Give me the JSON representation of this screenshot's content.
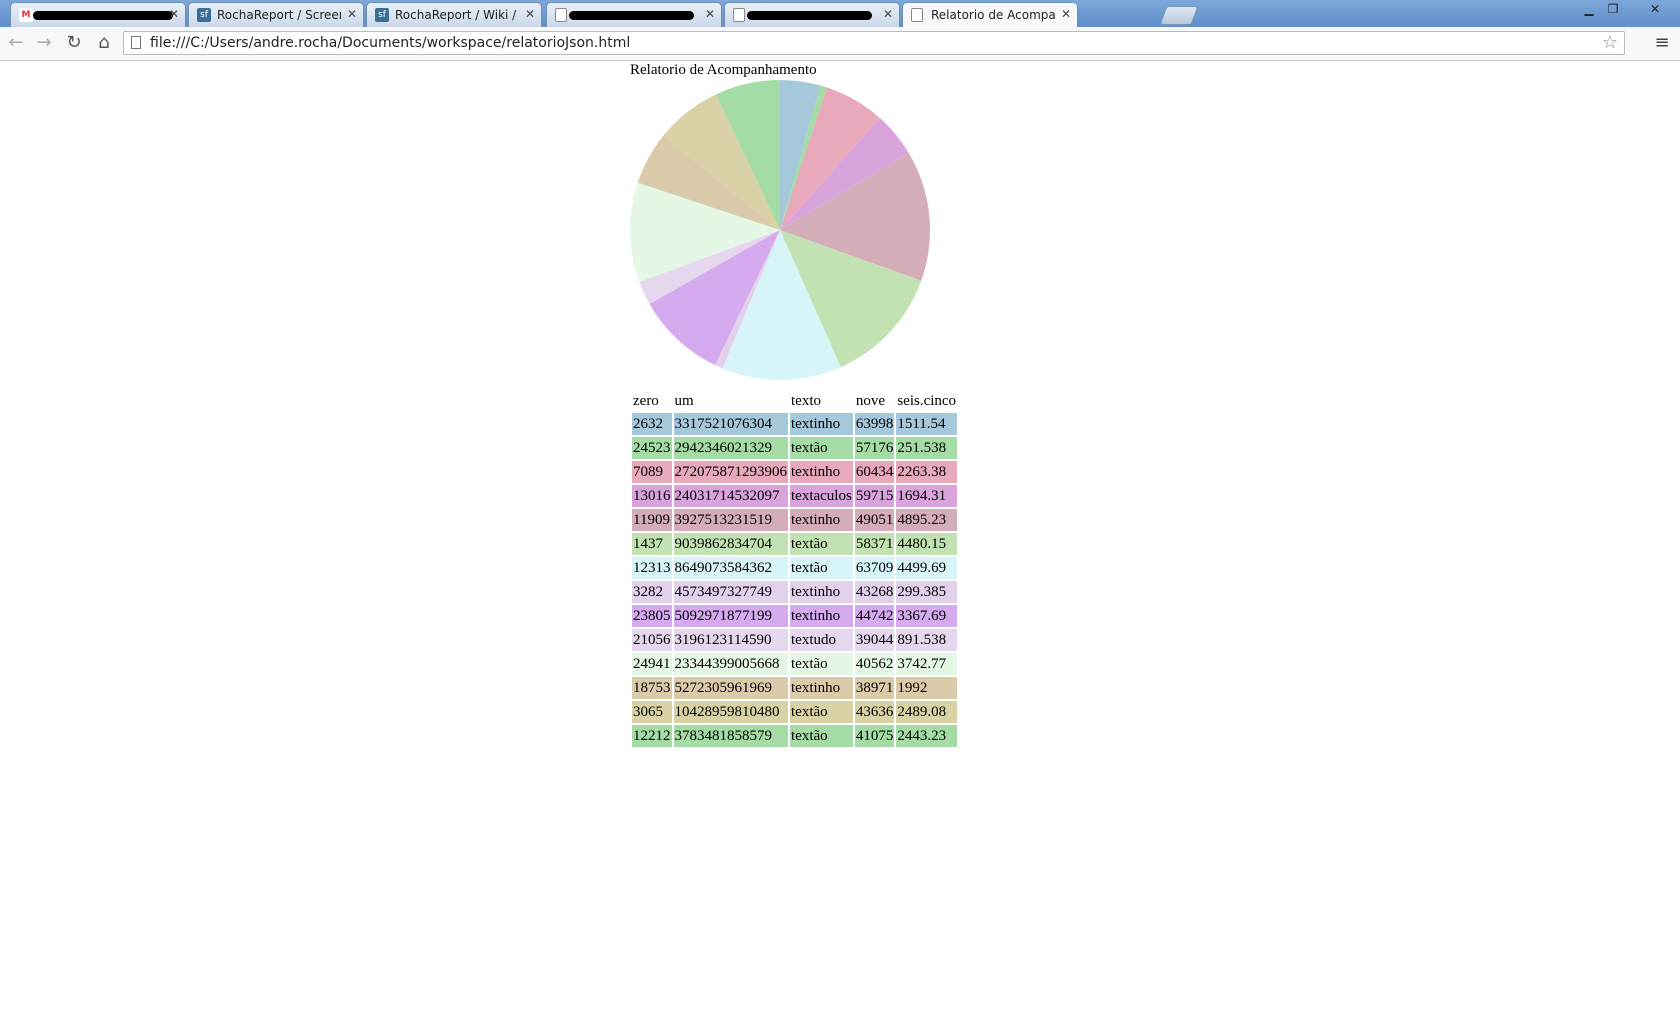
{
  "browser": {
    "tabs": [
      {
        "title": "",
        "favicon": "gmail-icon",
        "redacted": true,
        "active": false
      },
      {
        "title": "RochaReport / Screenshot",
        "favicon": "sf-icon",
        "redacted": false,
        "active": false
      },
      {
        "title": "RochaReport / Wiki / Brow",
        "favicon": "sf-icon",
        "redacted": false,
        "active": false
      },
      {
        "title": "",
        "favicon": "page-icon",
        "redacted": true,
        "active": false
      },
      {
        "title": "",
        "favicon": "page-icon",
        "redacted": true,
        "active": false
      },
      {
        "title": "Relatorio de Acompanhan",
        "favicon": "page-icon",
        "redacted": false,
        "active": true
      }
    ],
    "close_glyph": "✕",
    "window_controls": {
      "minimize": "▁",
      "maximize": "❐",
      "close": "✕"
    },
    "nav": {
      "back": "←",
      "forward": "→",
      "reload": "↻",
      "home": "⌂"
    },
    "url": "file:///C:/Users/andre.rocha/Documents/workspace/relatorioJson.html",
    "star": "☆",
    "menu": "≡"
  },
  "page": {
    "title": "Relatorio de Acompanhamento"
  },
  "chart_data": {
    "type": "pie",
    "title": "Relatorio de Acompanhamento",
    "categories": [
      "2632",
      "24523",
      "7089",
      "13016",
      "11909",
      "1437",
      "12313",
      "3282",
      "23805",
      "21056",
      "24941",
      "18753",
      "3065",
      "12212"
    ],
    "values": [
      1511.54,
      251.538,
      2263.38,
      1694.31,
      4895.23,
      4480.15,
      4499.69,
      299.385,
      3367.69,
      891.538,
      3742.77,
      1992,
      2489.08,
      2443.23
    ],
    "colors": [
      "#a6c8db",
      "#a5dba5",
      "#e8aabb",
      "#d9a3db",
      "#d5adb8",
      "#c3e2b3",
      "#d7f4f8",
      "#e1d1eb",
      "#d6aaee",
      "#e5d7ee",
      "#e5f7e5",
      "#dacbab",
      "#d9d2a6",
      "#a5dba5"
    ]
  },
  "table": {
    "headers": [
      "zero",
      "um",
      "texto",
      "nove",
      "seis.cinco"
    ],
    "rows": [
      {
        "color": "#a6c8db",
        "cells": [
          "2632",
          "3317521076304",
          "textinho",
          "63998",
          "1511.54"
        ]
      },
      {
        "color": "#a5dba5",
        "cells": [
          "24523",
          "2942346021329",
          "textão",
          "57176",
          "251.538"
        ]
      },
      {
        "color": "#e8aabb",
        "cells": [
          "7089",
          "272075871293906",
          "textinho",
          "60434",
          "2263.38"
        ]
      },
      {
        "color": "#d9a3db",
        "cells": [
          "13016",
          "24031714532097",
          "textaculos",
          "59715",
          "1694.31"
        ]
      },
      {
        "color": "#d5adb8",
        "cells": [
          "11909",
          "3927513231519",
          "textinho",
          "49051",
          "4895.23"
        ]
      },
      {
        "color": "#c3e2b3",
        "cells": [
          "1437",
          "9039862834704",
          "textão",
          "58371",
          "4480.15"
        ]
      },
      {
        "color": "#d7f4f8",
        "cells": [
          "12313",
          "8649073584362",
          "textão",
          "63709",
          "4499.69"
        ]
      },
      {
        "color": "#e1d1eb",
        "cells": [
          "3282",
          "4573497327749",
          "textinho",
          "43268",
          "299.385"
        ]
      },
      {
        "color": "#d6aaee",
        "cells": [
          "23805",
          "5092971877199",
          "textinho",
          "44742",
          "3367.69"
        ]
      },
      {
        "color": "#e5d7ee",
        "cells": [
          "21056",
          "3196123114590",
          "textudo",
          "39044",
          "891.538"
        ]
      },
      {
        "color": "#e5f7e5",
        "cells": [
          "24941",
          "23344399005668",
          "textão",
          "40562",
          "3742.77"
        ]
      },
      {
        "color": "#dacbab",
        "cells": [
          "18753",
          "5272305961969",
          "textinho",
          "38971",
          "1992"
        ]
      },
      {
        "color": "#d9d2a6",
        "cells": [
          "3065",
          "10428959810480",
          "textão",
          "43636",
          "2489.08"
        ]
      },
      {
        "color": "#a5dba5",
        "cells": [
          "12212",
          "3783481858579",
          "textão",
          "41075",
          "2443.23"
        ]
      }
    ]
  }
}
